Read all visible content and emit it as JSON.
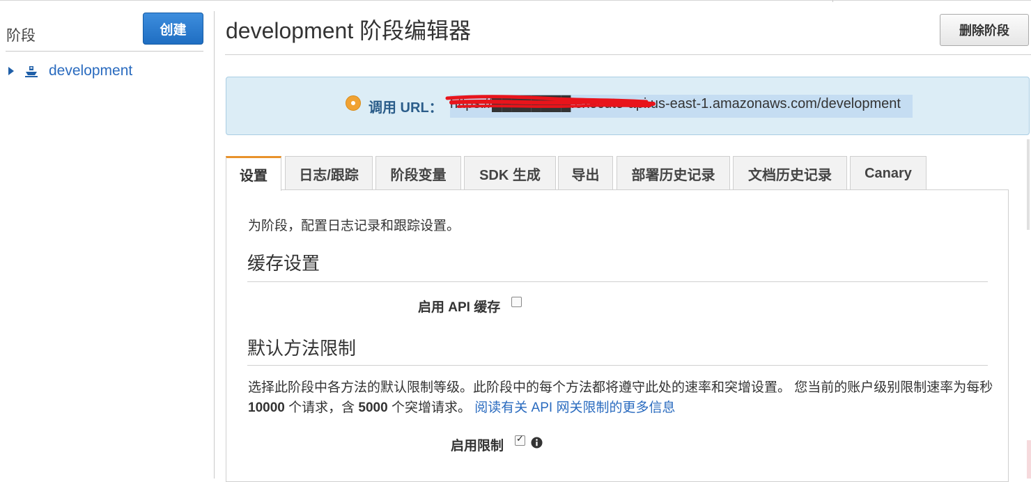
{
  "sidebar": {
    "title": "阶段",
    "create_label": "创建",
    "stages": [
      {
        "label": "development"
      }
    ]
  },
  "header": {
    "title": "development 阶段编辑器",
    "delete_label": "删除阶段"
  },
  "invoke": {
    "label": "调用 URL：",
    "url_visible": "https://████████.execute-api.us-east-1.amazonaws.com/development"
  },
  "tabs": [
    {
      "label": "设置",
      "active": true
    },
    {
      "label": "日志/跟踪"
    },
    {
      "label": "阶段变量"
    },
    {
      "label": "SDK 生成"
    },
    {
      "label": "导出"
    },
    {
      "label": "部署历史记录"
    },
    {
      "label": "文档历史记录"
    },
    {
      "label": "Canary"
    }
  ],
  "settings": {
    "intro": "为阶段，配置日志记录和跟踪设置。",
    "cache_heading": "缓存设置",
    "enable_cache_label": "启用 API 缓存",
    "enable_cache_checked": false,
    "throttle_heading": "默认方法限制",
    "throttle_desc_1": "选择此阶段中各方法的默认限制等级。此阶段中的每个方法都将遵守此处的速率和突增设置。 您当前的账户级别限制速率为每秒",
    "rate": "10000",
    "throttle_desc_2": "个请求，含",
    "burst": "5000",
    "throttle_desc_3": "个突增请求。",
    "throttle_link": "阅读有关 API 网关限制的更多信息",
    "enable_throttle_label": "启用限制",
    "enable_throttle_checked": true
  },
  "colors": {
    "accent_orange": "#e8922b",
    "primary_blue": "#1f6ec2",
    "link_blue": "#2a6bbf",
    "info_bg": "#dcedf6",
    "redaction": "#e8141b"
  }
}
